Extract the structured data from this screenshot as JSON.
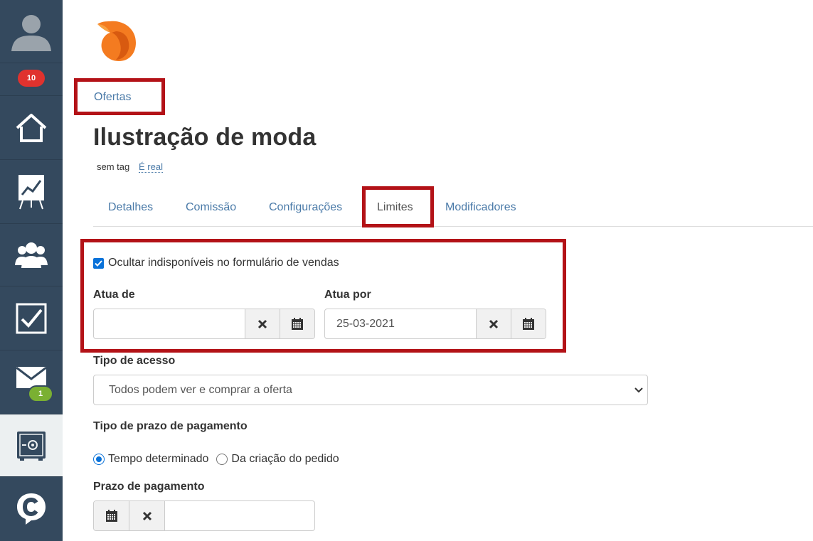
{
  "sidebar": {
    "notifications_badge": "10",
    "messages_badge": "1",
    "items": [
      {
        "name": "avatar",
        "icon": "user-icon"
      },
      {
        "name": "home",
        "icon": "home-icon"
      },
      {
        "name": "reports",
        "icon": "chart-board-icon"
      },
      {
        "name": "customers",
        "icon": "users-icon"
      },
      {
        "name": "tasks",
        "icon": "checkbox-icon"
      },
      {
        "name": "messages",
        "icon": "envelope-icon"
      },
      {
        "name": "offers",
        "icon": "safe-icon"
      },
      {
        "name": "chat",
        "icon": "chat-logo-icon"
      }
    ]
  },
  "breadcrumb": "Ofertas",
  "title": "Ilustração de moda",
  "tag": {
    "text": "sem tag",
    "link": "É real"
  },
  "tabs": [
    {
      "label": "Detalhes"
    },
    {
      "label": "Comissão"
    },
    {
      "label": "Configurações"
    },
    {
      "label": "Limites"
    },
    {
      "label": "Modificadores"
    }
  ],
  "active_tab": "Limites",
  "limits": {
    "hide_unavailable_label": "Ocultar indisponíveis no formulário de vendas",
    "hide_unavailable_checked": true,
    "from_label": "Atua de",
    "from_value": "",
    "to_label": "Atua por",
    "to_value": "25-03-2021"
  },
  "access": {
    "label": "Tipo de acesso",
    "selected": "Todos podem ver e comprar a oferta"
  },
  "payment_term_type": {
    "label": "Tipo de prazo de pagamento",
    "options": [
      "Tempo determinado",
      "Da criação do pedido"
    ],
    "selected": "Tempo determinado"
  },
  "payment_term": {
    "label": "Prazo de pagamento",
    "value": ""
  },
  "colors": {
    "sidebar": "#34495e",
    "highlight": "#b31217",
    "link": "#4a7aa8",
    "accent": "#0a72d9"
  }
}
